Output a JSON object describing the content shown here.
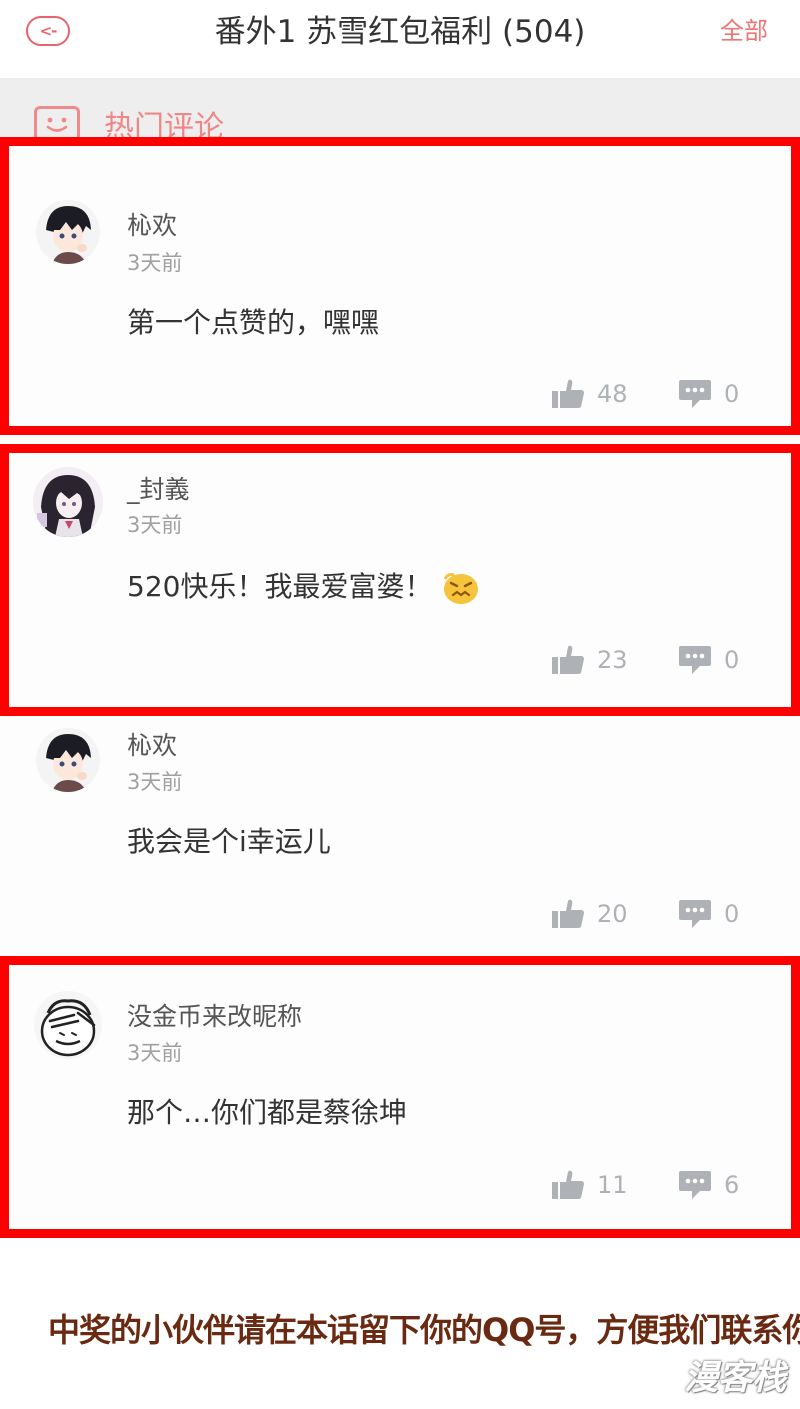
{
  "header": {
    "back_icon": "back-arrow-icon",
    "back_glyph": "<-",
    "title": "番外1 苏雪红包福利 (504)",
    "all_label": "全部"
  },
  "section": {
    "icon": "smiley-icon",
    "label": "热门评论"
  },
  "comments": [
    {
      "username": "杺欢",
      "time": "3天前",
      "content": "第一个点赞的，嘿嘿",
      "likes": "48",
      "replies": "0",
      "highlighted": true
    },
    {
      "username": "_封義",
      "time": "3天前",
      "content": "520快乐！我最爱富婆！",
      "likes": "23",
      "replies": "0",
      "highlighted": true,
      "emoji": "grimace-emoji"
    },
    {
      "username": "杺欢",
      "time": "3天前",
      "content": "我会是个i幸运儿",
      "likes": "20",
      "replies": "0",
      "highlighted": false
    },
    {
      "username": "没金币来改昵称",
      "time": "3天前",
      "content": "那个…你们都是蔡徐坤",
      "likes": "11",
      "replies": "6",
      "highlighted": true
    }
  ],
  "footer": {
    "note": "中奖的小伙伴请在本话留下你的QQ号，方便我们联系你~",
    "watermark": "漫客栈"
  },
  "colors": {
    "accent": "#ef7575",
    "highlight_border": "#ff0000",
    "stat_gray": "#aeb1b6",
    "note_text": "#6a2a12"
  }
}
